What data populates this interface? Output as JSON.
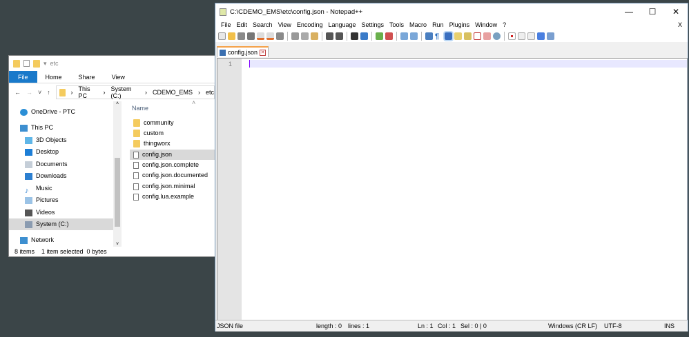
{
  "explorer": {
    "location": "etc",
    "tabs": [
      "File",
      "Home",
      "Share",
      "View"
    ],
    "breadcrumb": [
      "This PC",
      "System (C:)",
      "CDEMO_EMS",
      "etc"
    ],
    "nav": [
      {
        "label": "OneDrive - PTC",
        "icon": "cloud-icon"
      },
      {
        "label": "This PC",
        "icon": "computer-icon"
      },
      {
        "label": "3D Objects",
        "icon": "cube-icon"
      },
      {
        "label": "Desktop",
        "icon": "desktop-icon"
      },
      {
        "label": "Documents",
        "icon": "documents-icon"
      },
      {
        "label": "Downloads",
        "icon": "download-icon"
      },
      {
        "label": "Music",
        "icon": "music-icon"
      },
      {
        "label": "Pictures",
        "icon": "pictures-icon"
      },
      {
        "label": "Videos",
        "icon": "videos-icon"
      },
      {
        "label": "System (C:)",
        "icon": "drive-icon",
        "selected": true
      },
      {
        "label": "Network",
        "icon": "network-icon"
      }
    ],
    "column": "Name",
    "files": [
      {
        "name": "community",
        "type": "folder"
      },
      {
        "name": "custom",
        "type": "folder"
      },
      {
        "name": "thingworx",
        "type": "folder"
      },
      {
        "name": "config.json",
        "type": "file",
        "selected": true
      },
      {
        "name": "config.json.complete",
        "type": "file"
      },
      {
        "name": "config.json.documented",
        "type": "file"
      },
      {
        "name": "config.json.minimal",
        "type": "file"
      },
      {
        "name": "config.lua.example",
        "type": "file"
      }
    ],
    "status": {
      "items": "8 items",
      "selected": "1 item selected",
      "size": "0 bytes"
    }
  },
  "npp": {
    "title": "C:\\CDEMO_EMS\\etc\\config.json - Notepad++",
    "menu": [
      "File",
      "Edit",
      "Search",
      "View",
      "Encoding",
      "Language",
      "Settings",
      "Tools",
      "Macro",
      "Run",
      "Plugins",
      "Window",
      "?"
    ],
    "close_doc": "X",
    "tab": "config.json",
    "line_number": "1",
    "status": {
      "type": "JSON file",
      "length": "length : 0",
      "lines": "lines : 1",
      "ln": "Ln : 1",
      "col": "Col : 1",
      "sel": "Sel : 0 | 0",
      "eol": "Windows (CR LF)",
      "enc": "UTF-8",
      "mode": "INS"
    }
  }
}
